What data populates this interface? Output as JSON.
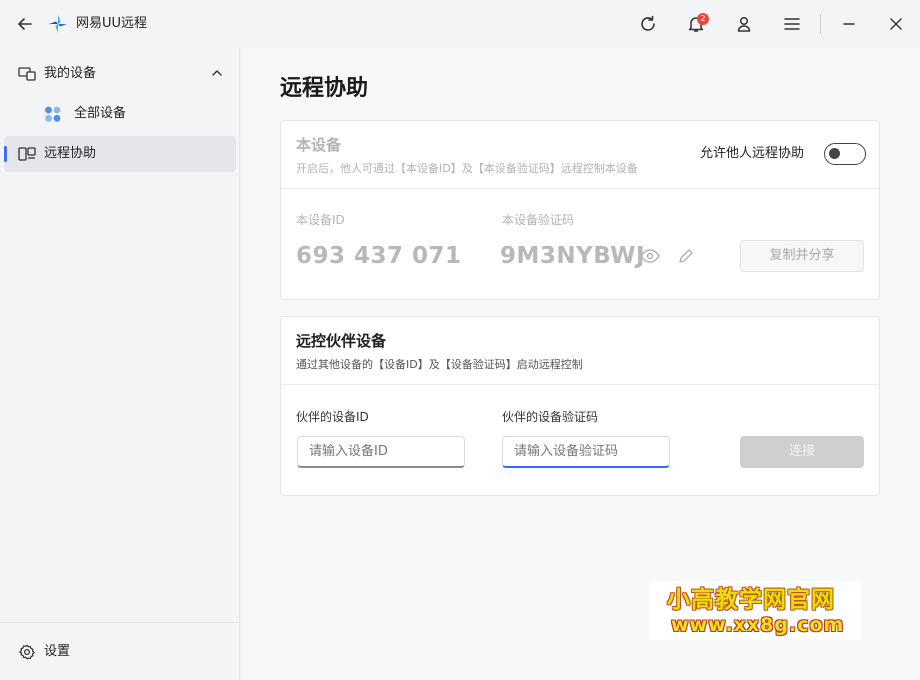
{
  "app": {
    "title": "网易UU远程",
    "notification_count": "2"
  },
  "sidebar": {
    "my_devices": "我的设备",
    "all_devices": "全部设备",
    "remote_assist": "远程协助",
    "settings": "设置"
  },
  "main": {
    "page_title": "远程协助",
    "this_device": {
      "title": "本设备",
      "desc": "开启后，他人可通过【本设备ID】及【本设备验证码】远程控制本设备",
      "allow_label": "允许他人远程协助",
      "allow_enabled": false,
      "id_label": "本设备ID",
      "id_value": "693 437 071",
      "code_label": "本设备验证码",
      "code_value": "9M3NYBWJ",
      "copy_share": "复制并分享"
    },
    "partner": {
      "title": "远控伙伴设备",
      "desc": "通过其他设备的【设备ID】及【设备验证码】启动远程控制",
      "id_label": "伙伴的设备ID",
      "id_placeholder": "请输入设备ID",
      "code_label": "伙伴的设备验证码",
      "code_placeholder": "请输入设备验证码",
      "connect": "连接"
    }
  },
  "watermark": {
    "line1": "小高教学网官网",
    "line2": "www.xx8g.com"
  }
}
